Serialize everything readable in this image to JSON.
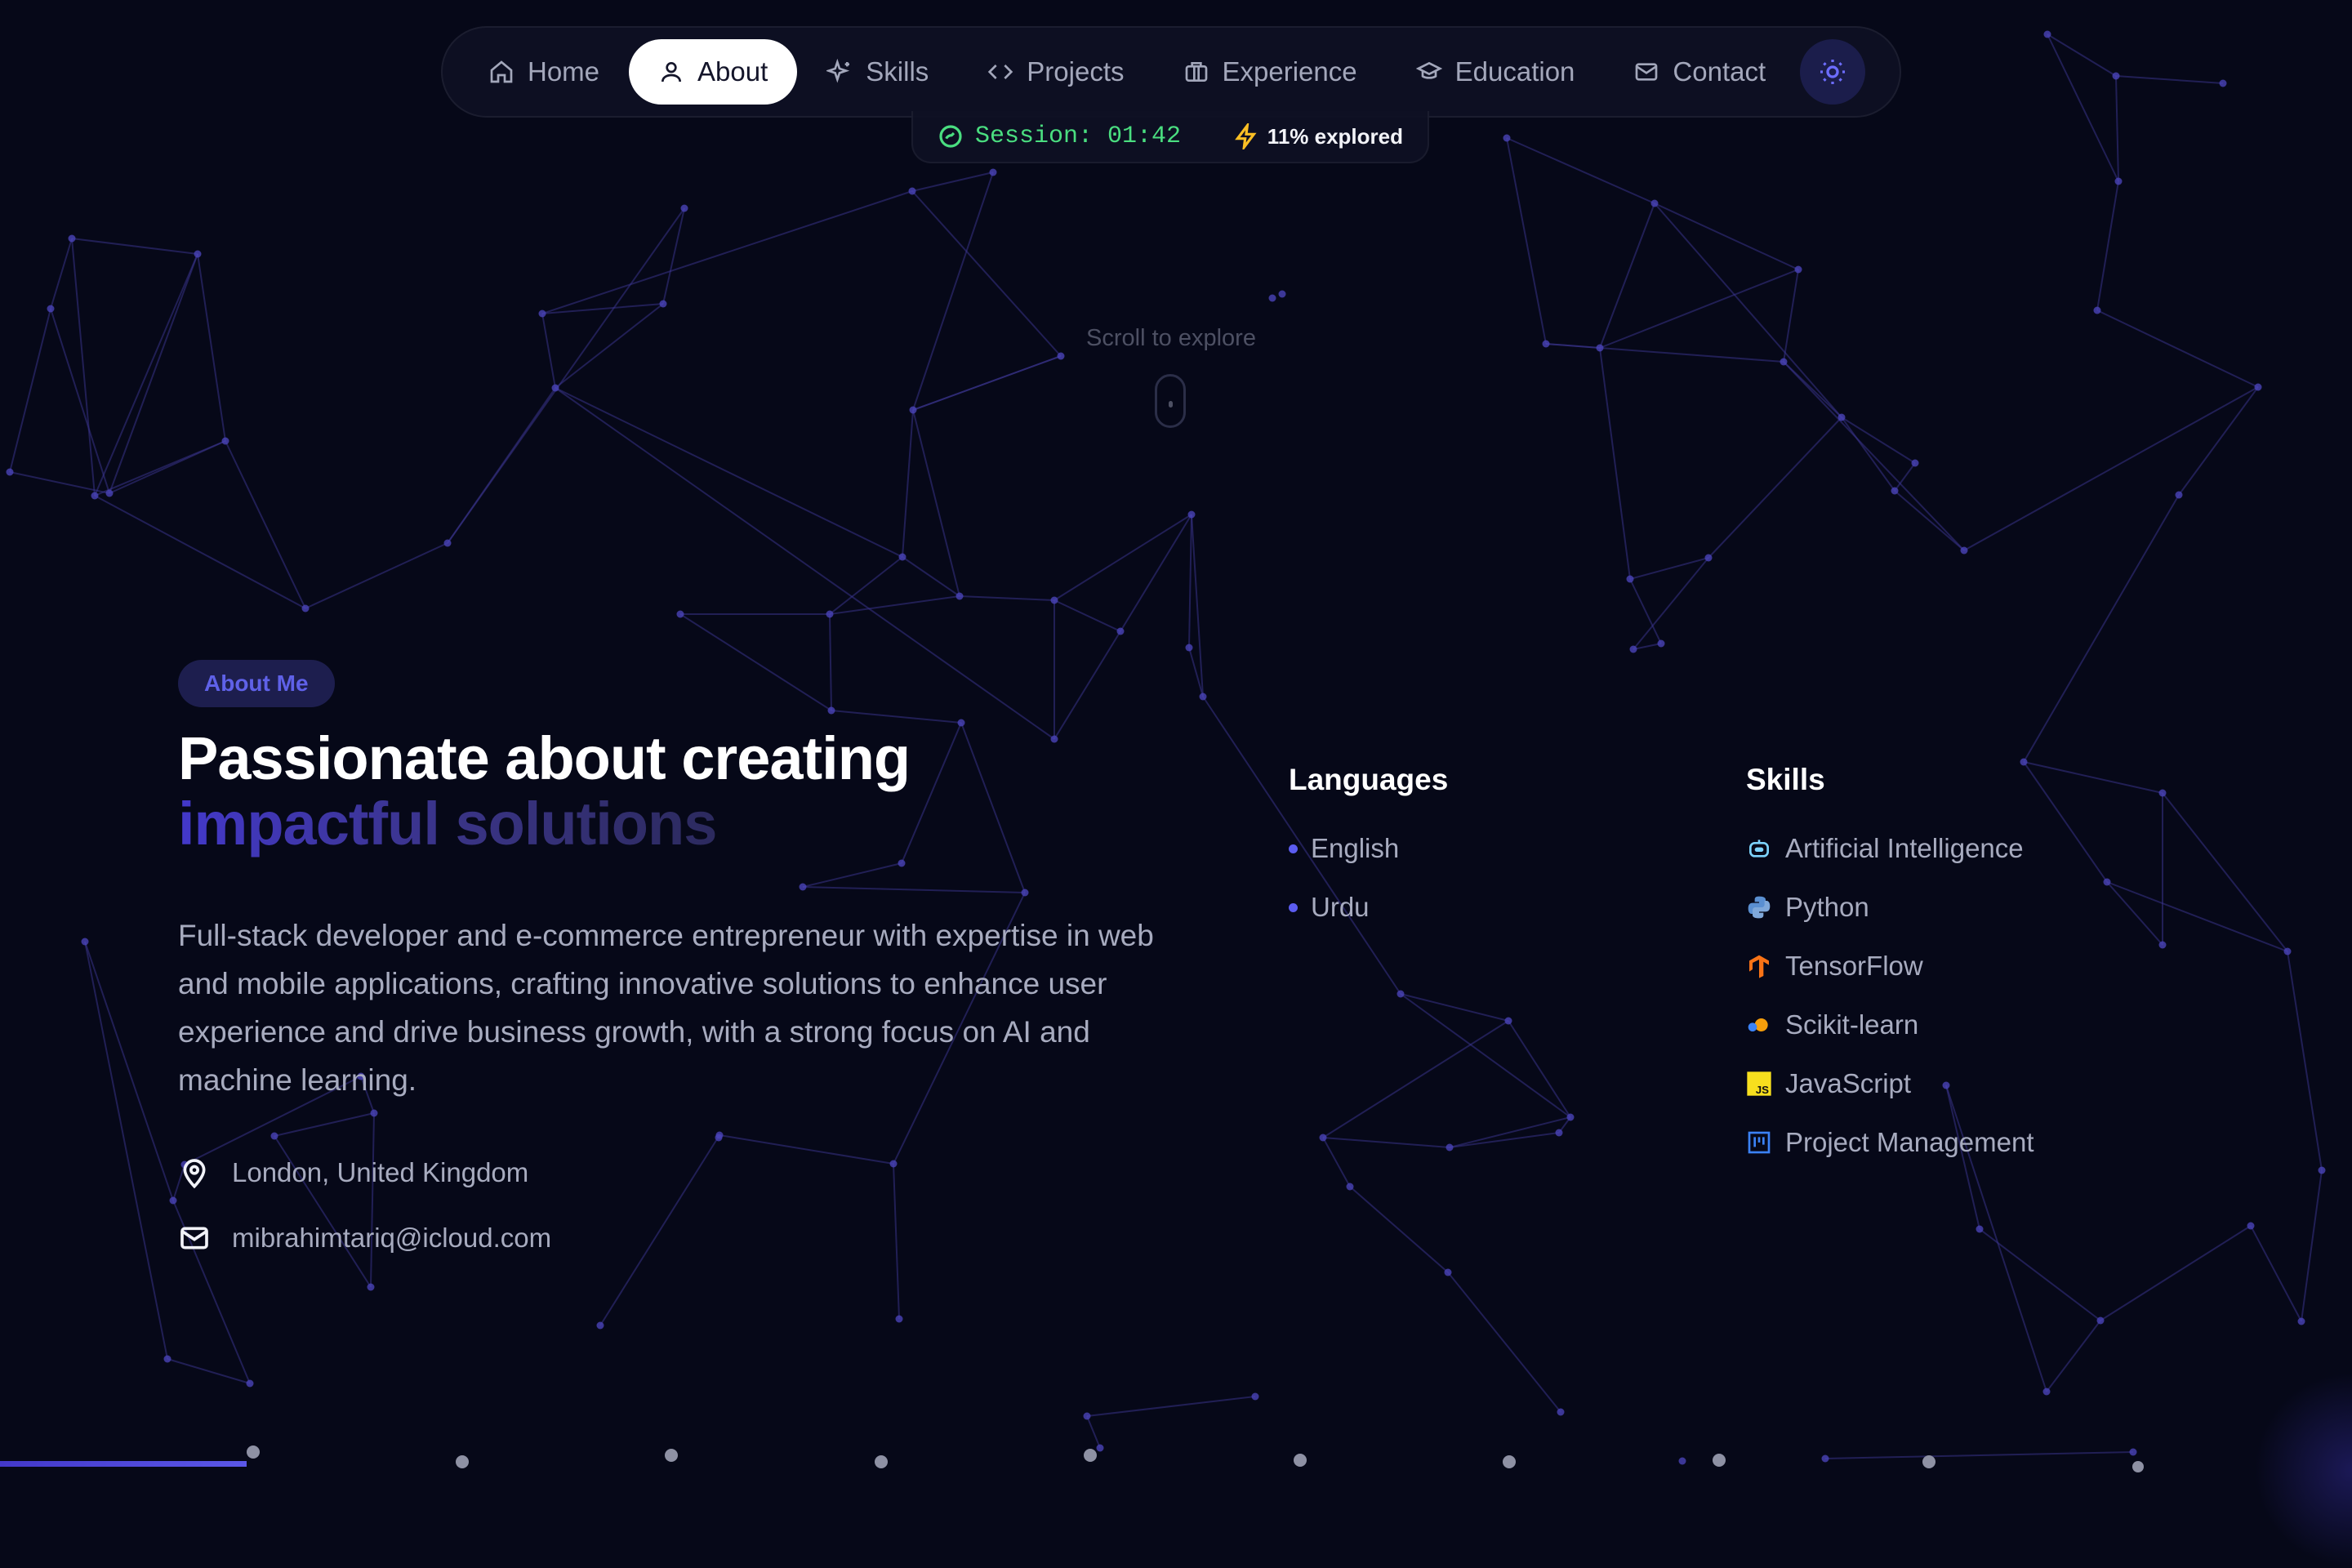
{
  "nav": {
    "items": [
      {
        "label": "Home",
        "icon": "home-icon"
      },
      {
        "label": "About",
        "icon": "user-icon"
      },
      {
        "label": "Skills",
        "icon": "sparkles-icon"
      },
      {
        "label": "Projects",
        "icon": "code-icon"
      },
      {
        "label": "Experience",
        "icon": "briefcase-icon"
      },
      {
        "label": "Education",
        "icon": "graduation-cap-icon"
      },
      {
        "label": "Contact",
        "icon": "mail-icon"
      }
    ],
    "active": "About",
    "theme_toggle_icon": "sun-icon"
  },
  "session": {
    "timer": "Session: 01:42",
    "explored": "11% explored",
    "timer_color": "#4ade80",
    "explored_icon_color": "#fbbf24"
  },
  "scroll_hint": "Scroll to explore",
  "about": {
    "badge": "About Me",
    "title_line1": "Passionate about creating",
    "title_line2": "impactful solutions",
    "description": "Full-stack developer and e-commerce entrepreneur with expertise in web and mobile applications, crafting innovative solutions to enhance user experience and drive business growth, with a strong focus on AI and machine learning.",
    "location": "London, United Kingdom",
    "email": "mibrahimtariq@icloud.com"
  },
  "languages": {
    "title": "Languages",
    "items": [
      "English",
      "Urdu"
    ]
  },
  "skills": {
    "title": "Skills",
    "items": [
      {
        "label": "Artificial Intelligence",
        "icon": "robot-icon"
      },
      {
        "label": "Python",
        "icon": "python-icon"
      },
      {
        "label": "TensorFlow",
        "icon": "tensorflow-icon"
      },
      {
        "label": "Scikit-learn",
        "icon": "scikit-learn-icon"
      },
      {
        "label": "JavaScript",
        "icon": "javascript-icon"
      },
      {
        "label": "Project Management",
        "icon": "kanban-icon"
      }
    ]
  },
  "theme": {
    "background": "#060818",
    "accent": "#4f46e5",
    "network_line": "#3b3591"
  }
}
